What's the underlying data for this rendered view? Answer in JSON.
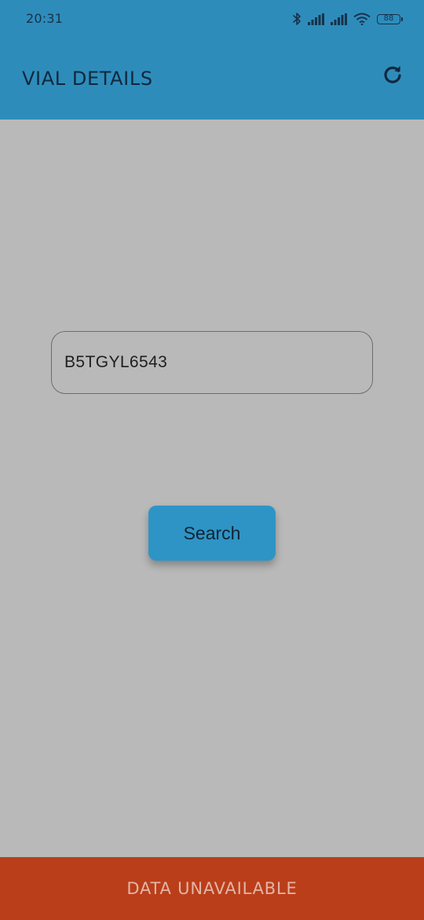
{
  "status_bar": {
    "time": "20:31",
    "battery": "88",
    "icons": [
      "bluetooth-icon",
      "signal-icon",
      "signal-icon",
      "wifi-icon",
      "battery-icon"
    ]
  },
  "header": {
    "title": "VIAL DETAILS",
    "refresh_icon": "refresh-icon",
    "background": "#2e8cbb"
  },
  "search": {
    "value": "B5TGYL6543",
    "button_label": "Search",
    "button_color": "#2e94c5"
  },
  "footer": {
    "banner_text": "DATA UNAVAILABLE",
    "background": "#bb3e1a"
  }
}
